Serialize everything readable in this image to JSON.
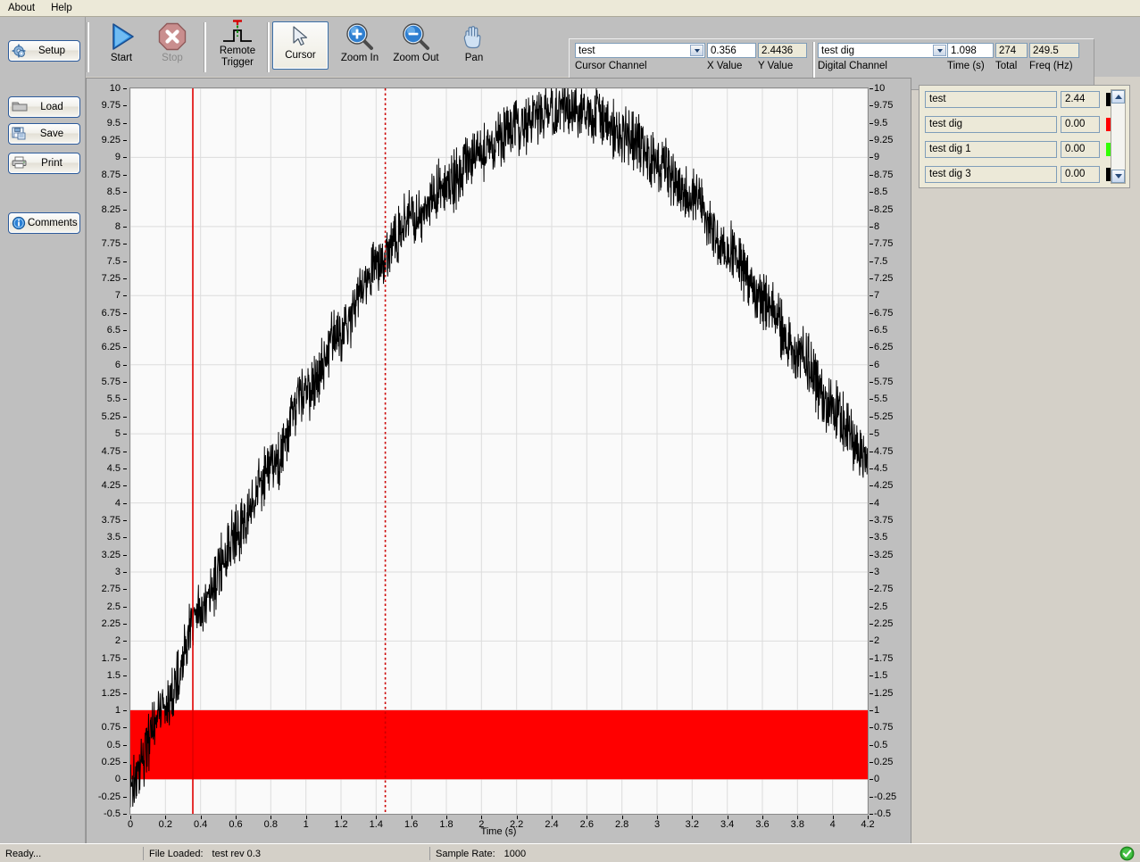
{
  "menu": {
    "items": [
      "About",
      "Help"
    ]
  },
  "sidebar": {
    "buttons": [
      {
        "id": "setup",
        "label": "Setup",
        "icon": "gear-icon"
      },
      {
        "id": "load",
        "label": "Load",
        "icon": "folder-icon"
      },
      {
        "id": "save",
        "label": "Save",
        "icon": "save-disk-icon"
      },
      {
        "id": "print",
        "label": "Print",
        "icon": "printer-icon"
      },
      {
        "id": "comments",
        "label": "Comments",
        "icon": "info-icon"
      }
    ]
  },
  "toolbar": {
    "start_label": "Start",
    "stop_label": "Stop",
    "remote_trigger_label_1": "Remote",
    "remote_trigger_label_2": "Trigger",
    "cursor_label": "Cursor",
    "zoom_in_label": "Zoom In",
    "zoom_out_label": "Zoom Out",
    "pan_label": "Pan",
    "selected_tool": "Cursor",
    "fields": {
      "cursor_channel_value": "test",
      "cursor_channel_label": "Cursor Channel",
      "x_value": "0.356",
      "x_value_label": "X Value",
      "y_value": "2.4436",
      "y_value_label": "Y Value",
      "digital_channel_value": "test dig",
      "digital_channel_label": "Digital Channel",
      "time_value": "1.098",
      "time_label": "Time (s)",
      "total_value": "274",
      "total_label": "Total",
      "freq_value": "249.5",
      "freq_label": "Freq (Hz)"
    }
  },
  "channels": {
    "rows": [
      {
        "name": "test",
        "value": "2.44",
        "color": "#000000"
      },
      {
        "name": "test dig",
        "value": "0.00",
        "color": "#ff0000"
      },
      {
        "name": "test dig 1",
        "value": "0.00",
        "color": "#33ff00"
      },
      {
        "name": "test dig 3",
        "value": "0.00",
        "color": "#000000"
      }
    ]
  },
  "statusbar": {
    "ready": "Ready...",
    "file_loaded_label": "File Loaded:",
    "file_loaded_value": "test rev 0.3",
    "sample_rate_label": "Sample Rate:",
    "sample_rate_value": "1000",
    "status_icon": "green-check-icon"
  },
  "chart_data": {
    "type": "line",
    "title": "",
    "xlabel": "Time (s)",
    "ylabel": "",
    "xlim": [
      0,
      4.2
    ],
    "ylim": [
      -0.5,
      10
    ],
    "grid": true,
    "x_ticks": [
      "0",
      "0.2",
      "0.4",
      "0.6",
      "0.8",
      "1",
      "1.2",
      "1.4",
      "1.6",
      "1.8",
      "2",
      "2.2",
      "2.4",
      "2.6",
      "2.8",
      "3",
      "3.2",
      "3.4",
      "3.6",
      "3.8",
      "4",
      "4.2"
    ],
    "y_ticks": [
      "10",
      "9.75",
      "9.5",
      "9.25",
      "9",
      "8.75",
      "8.5",
      "8.25",
      "8",
      "7.75",
      "7.5",
      "7.25",
      "7",
      "6.75",
      "6.5",
      "6.25",
      "6",
      "5.75",
      "5.5",
      "5.25",
      "5",
      "4.75",
      "4.5",
      "4.25",
      "4",
      "3.75",
      "3.5",
      "3.25",
      "3",
      "2.75",
      "2.5",
      "2.25",
      "2",
      "1.75",
      "1.5",
      "1.25",
      "1",
      "0.75",
      "0.5",
      "0.25",
      "0",
      "-0.25",
      "-0.5"
    ],
    "right_axis_same_as_left": true,
    "series": [
      {
        "name": "test",
        "color": "#000000",
        "style": "noisy-parabola",
        "description": "Noisy analog trace rising from ~0 at t=0 to peak ~9.8 near t=2.45 then falling to ~4.6 at t=4.2",
        "noise_amplitude": 0.35,
        "anchor_points": [
          {
            "t": 0.0,
            "v": -0.1
          },
          {
            "t": 0.2,
            "v": 1.1
          },
          {
            "t": 0.4,
            "v": 2.45
          },
          {
            "t": 0.6,
            "v": 3.55
          },
          {
            "t": 0.8,
            "v": 4.5
          },
          {
            "t": 1.0,
            "v": 5.55
          },
          {
            "t": 1.2,
            "v": 6.5
          },
          {
            "t": 1.4,
            "v": 7.45
          },
          {
            "t": 1.6,
            "v": 8.1
          },
          {
            "t": 1.8,
            "v": 8.6
          },
          {
            "t": 2.0,
            "v": 9.1
          },
          {
            "t": 2.2,
            "v": 9.45
          },
          {
            "t": 2.45,
            "v": 9.72
          },
          {
            "t": 2.6,
            "v": 9.65
          },
          {
            "t": 2.8,
            "v": 9.35
          },
          {
            "t": 3.0,
            "v": 8.95
          },
          {
            "t": 3.2,
            "v": 8.4
          },
          {
            "t": 3.4,
            "v": 7.7
          },
          {
            "t": 3.6,
            "v": 6.95
          },
          {
            "t": 3.8,
            "v": 6.2
          },
          {
            "t": 4.0,
            "v": 5.35
          },
          {
            "t": 4.2,
            "v": 4.62
          }
        ]
      },
      {
        "name": "test dig",
        "color": "#ff0000",
        "style": "digital-band",
        "description": "Digital channel shown as solid filled band between 0 and 1 across the full record",
        "low": 0,
        "high": 1,
        "t_start": 0.0,
        "t_end": 4.2
      }
    ],
    "cursors": [
      {
        "name": "cursor-primary",
        "t": 0.356,
        "color": "#e00000",
        "style": "solid"
      },
      {
        "name": "cursor-secondary",
        "t": 1.452,
        "color": "#cc0000",
        "style": "dotted"
      }
    ]
  }
}
